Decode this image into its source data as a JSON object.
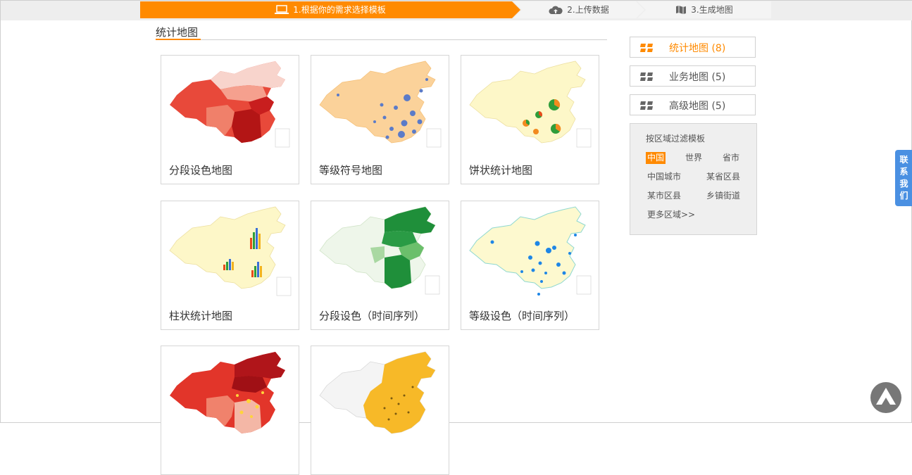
{
  "steps": [
    {
      "label": "1.根据你的需求选择模板",
      "icon": "laptop-icon"
    },
    {
      "label": "2.上传数据",
      "icon": "cloud-upload-icon"
    },
    {
      "label": "3.生成地图",
      "icon": "map-icon"
    }
  ],
  "section_title": "统计地图",
  "templates": [
    {
      "caption": "分段设色地图",
      "thumb": "choropleth-map"
    },
    {
      "caption": "等级符号地图",
      "thumb": "graduated-symbol-map"
    },
    {
      "caption": "饼状统计地图",
      "thumb": "pie-chart-map"
    },
    {
      "caption": "柱状统计地图",
      "thumb": "bar-chart-map"
    },
    {
      "caption": "分段设色（时间序列）",
      "thumb": "choropleth-time-series-map"
    },
    {
      "caption": "等级设色（时间序列）",
      "thumb": "graduated-color-time-series-map"
    },
    {
      "caption": "",
      "thumb": "heat-dot-map"
    },
    {
      "caption": "",
      "thumb": "yellow-dot-map"
    }
  ],
  "categories": [
    {
      "label": "统计地图 (8)",
      "active": true
    },
    {
      "label": "业务地图 (5)",
      "active": false
    },
    {
      "label": "高级地图 (5)",
      "active": false
    }
  ],
  "filter": {
    "title": "按区域过滤模板",
    "options": [
      "中国",
      "世界",
      "省市",
      "中国城市",
      "某省区县",
      "某市区县",
      "乡镇街道"
    ],
    "selected": "中国",
    "more": "更多区域>>"
  },
  "contact": [
    "联",
    "系",
    "我",
    "们"
  ],
  "colors": {
    "accent": "#ff8a00",
    "contact": "#4a90e2"
  }
}
